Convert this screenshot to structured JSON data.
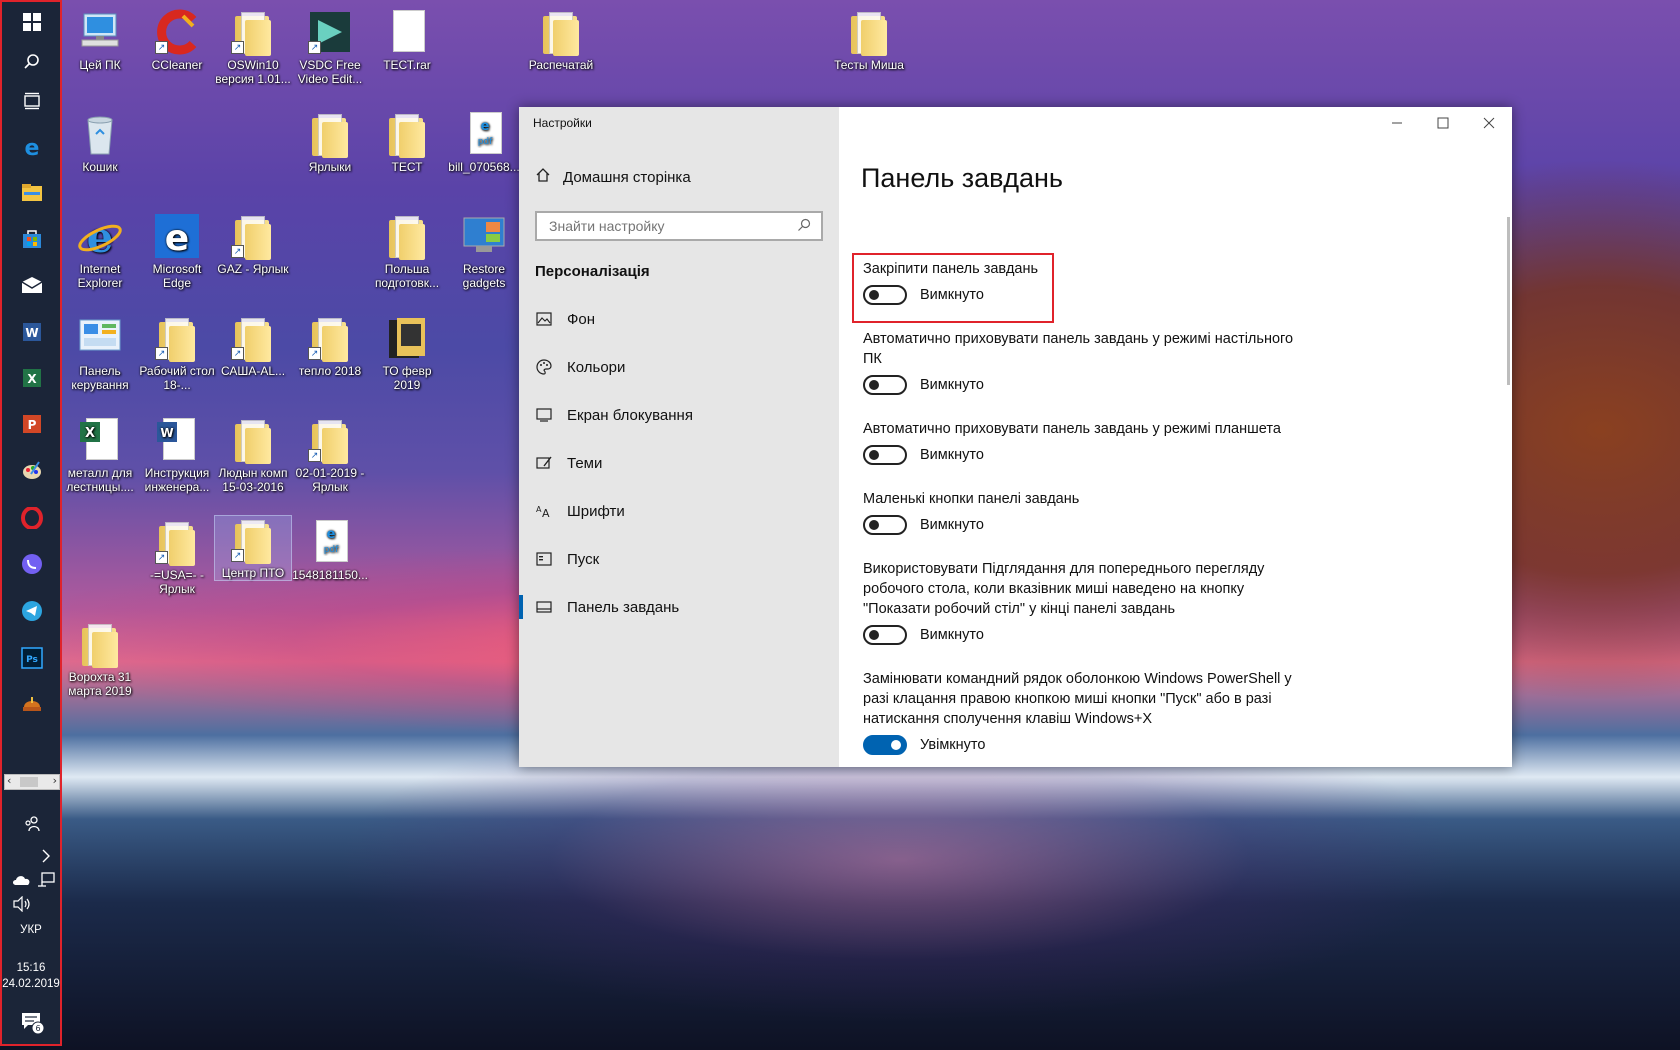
{
  "taskbar": {
    "apps": [
      {
        "name": "start",
        "icon": "windows-logo-icon"
      },
      {
        "name": "search",
        "icon": "search-icon"
      },
      {
        "name": "task-view",
        "icon": "task-view-icon"
      },
      {
        "name": "edge",
        "icon": "edge-icon"
      },
      {
        "name": "file-explorer",
        "icon": "folder-icon"
      },
      {
        "name": "store",
        "icon": "store-icon"
      },
      {
        "name": "mail",
        "icon": "mail-icon"
      },
      {
        "name": "word",
        "icon": "word-icon"
      },
      {
        "name": "excel",
        "icon": "excel-icon"
      },
      {
        "name": "powerpoint",
        "icon": "powerpoint-icon"
      },
      {
        "name": "paint",
        "icon": "paint-icon"
      },
      {
        "name": "opera",
        "icon": "opera-icon"
      },
      {
        "name": "viber",
        "icon": "viber-icon"
      },
      {
        "name": "telegram",
        "icon": "telegram-icon"
      },
      {
        "name": "photoshop",
        "icon": "photoshop-icon"
      },
      {
        "name": "helmet-app",
        "icon": "helmet-icon"
      }
    ],
    "language": "УКР",
    "time": "15:16",
    "date": "24.02.2019",
    "notification_count": "6"
  },
  "desktop": {
    "icons": [
      {
        "label": "Цей ПК",
        "type": "pc"
      },
      {
        "label": "CCleaner",
        "type": "ccleaner"
      },
      {
        "label": "OSWin10 версия 1.01...",
        "type": "folder"
      },
      {
        "label": "VSDC Free Video Edit...",
        "type": "vsdc"
      },
      {
        "label": "ТЕСТ.rar",
        "type": "file"
      },
      {
        "label": "Распечатай",
        "type": "folder"
      },
      {
        "label": "Тесты Миша",
        "type": "folder"
      },
      {
        "label": "Кошик",
        "type": "recycle"
      },
      {
        "label": "Ярлыки",
        "type": "folder"
      },
      {
        "label": "ТЕСТ",
        "type": "folder"
      },
      {
        "label": "bill_070568...",
        "type": "pdf"
      },
      {
        "label": "Internet Explorer",
        "type": "ie"
      },
      {
        "label": "Microsoft Edge",
        "type": "edge"
      },
      {
        "label": "GAZ - Ярлык",
        "type": "folder"
      },
      {
        "label": "Польша подготовк...",
        "type": "folder"
      },
      {
        "label": "Restore gadgets",
        "type": "gadgets"
      },
      {
        "label": "Панель керування",
        "type": "control"
      },
      {
        "label": "Рабочий стол 18-...",
        "type": "folder"
      },
      {
        "label": "САША-АL...",
        "type": "folder"
      },
      {
        "label": "тепло 2018",
        "type": "folder"
      },
      {
        "label": "ТО февр 2019",
        "type": "folder-dark"
      },
      {
        "label": "металл для лестницы....",
        "type": "excel"
      },
      {
        "label": "Инструкция инженера...",
        "type": "word"
      },
      {
        "label": "Людын комп 15-03-2016",
        "type": "folder"
      },
      {
        "label": "02-01-2019 - Ярлык",
        "type": "folder"
      },
      {
        "label": "-=USA=- - Ярлык",
        "type": "folder"
      },
      {
        "label": "Центр ПТО",
        "type": "folder"
      },
      {
        "label": "1548181150...",
        "type": "pdf"
      },
      {
        "label": "Ворохта 31 марта 2019",
        "type": "folder"
      }
    ]
  },
  "settings": {
    "app_title": "Настройки",
    "home_label": "Домашня сторінка",
    "search_placeholder": "Знайти настройку",
    "section_title": "Персоналізація",
    "nav": [
      {
        "label": "Фон",
        "icon": "picture-icon"
      },
      {
        "label": "Кольори",
        "icon": "palette-icon"
      },
      {
        "label": "Екран блокування",
        "icon": "lock-screen-icon"
      },
      {
        "label": "Теми",
        "icon": "themes-icon"
      },
      {
        "label": "Шрифти",
        "icon": "fonts-icon"
      },
      {
        "label": "Пуск",
        "icon": "start-menu-icon"
      },
      {
        "label": "Панель завдань",
        "icon": "taskbar-icon",
        "active": true
      }
    ],
    "page_title": "Панель завдань",
    "options": [
      {
        "label": "Закріпити панель завдань",
        "state": "Вимкнуто",
        "on": false,
        "highlighted": true
      },
      {
        "label": "Автоматично приховувати панель завдань у режимі настільного ПК",
        "state": "Вимкнуто",
        "on": false
      },
      {
        "label": "Автоматично приховувати панель завдань у режимі планшета",
        "state": "Вимкнуто",
        "on": false
      },
      {
        "label": "Маленькі кнопки панелі завдань",
        "state": "Вимкнуто",
        "on": false
      },
      {
        "label": "Використовувати Підглядання для попереднього перегляду робочого стола, коли вказівник миші наведено на кнопку \"Показати робочий стіл\" у кінці панелі завдань",
        "state": "Вимкнуто",
        "on": false
      },
      {
        "label": "Замінювати командний рядок оболонкою Windows PowerShell у разі клацання правою кнопкою миші кнопки \"Пуск\" або в разі натискання сполучення клавіш Windows+X",
        "state": "Увімкнуто",
        "on": true
      }
    ]
  },
  "colors": {
    "accent": "#0063b1",
    "highlight_box": "#e0232b",
    "taskbar_bg": "#1b2538"
  }
}
